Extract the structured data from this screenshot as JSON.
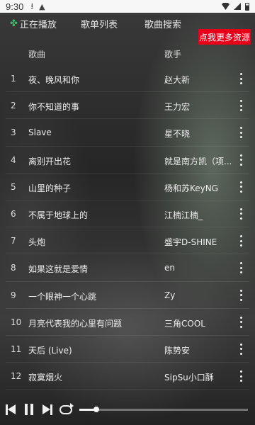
{
  "status_bar": {
    "time": "9:30",
    "icons": [
      "download-icon",
      "warning-icon",
      "wifi-icon",
      "signal-icon",
      "battery-icon"
    ]
  },
  "tabs": {
    "now_playing": "正在播放",
    "playlist": "歌单列表",
    "search": "歌曲搜索",
    "now_playing_icon": "clover-icon",
    "accent_color": "#3bbf6b"
  },
  "promo": {
    "label": "点我更多资源",
    "color": "#e8001a"
  },
  "table": {
    "header_song": "歌曲",
    "header_artist": "歌手",
    "rows": [
      {
        "num": "1",
        "title": "夜、晚风和你",
        "artist": "赵大新"
      },
      {
        "num": "2",
        "title": "你不知道的事",
        "artist": "王力宏"
      },
      {
        "num": "3",
        "title": "Slave",
        "artist": "星不晓"
      },
      {
        "num": "4",
        "title": "离别开出花",
        "artist": "就是南方凯（项..."
      },
      {
        "num": "5",
        "title": "山里的种子",
        "artist": "杨和苏KeyNG"
      },
      {
        "num": "6",
        "title": "不属于地球上的",
        "artist": "江楠江楠_"
      },
      {
        "num": "7",
        "title": "头炮",
        "artist": "盛宇D-SHINE"
      },
      {
        "num": "8",
        "title": "如果这就是爱情",
        "artist": "en"
      },
      {
        "num": "9",
        "title": "一个眼神一个心跳",
        "artist": "Zy"
      },
      {
        "num": "10",
        "title": "月亮代表我的心里有问题",
        "artist": "三角COOL"
      },
      {
        "num": "11",
        "title": "天后 (Live)",
        "artist": "陈势安"
      },
      {
        "num": "12",
        "title": "寂寞烟火",
        "artist": "SipSu小口酥"
      }
    ]
  },
  "player": {
    "progress_fraction": 0.1
  }
}
